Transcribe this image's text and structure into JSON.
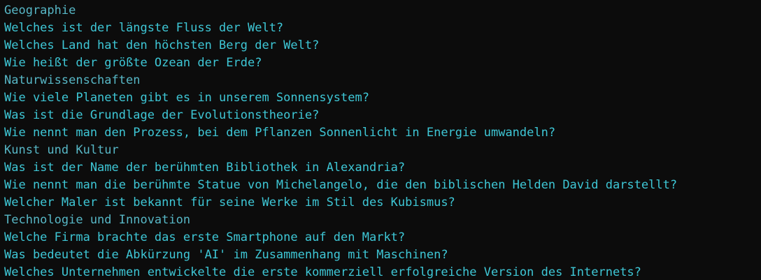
{
  "terminal": {
    "lines": [
      {
        "kind": "category",
        "text": "Geographie"
      },
      {
        "kind": "question",
        "text": "Welches ist der längste Fluss der Welt?"
      },
      {
        "kind": "question",
        "text": "Welches Land hat den höchsten Berg der Welt?"
      },
      {
        "kind": "question",
        "text": "Wie heißt der größte Ozean der Erde?"
      },
      {
        "kind": "category",
        "text": "Naturwissenschaften"
      },
      {
        "kind": "question",
        "text": "Wie viele Planeten gibt es in unserem Sonnensystem?"
      },
      {
        "kind": "question",
        "text": "Was ist die Grundlage der Evolutionstheorie?"
      },
      {
        "kind": "question",
        "text": "Wie nennt man den Prozess, bei dem Pflanzen Sonnenlicht in Energie umwandeln?"
      },
      {
        "kind": "category",
        "text": "Kunst und Kultur"
      },
      {
        "kind": "question",
        "text": "Was ist der Name der berühmten Bibliothek in Alexandria?"
      },
      {
        "kind": "question",
        "text": "Wie nennt man die berühmte Statue von Michelangelo, die den biblischen Helden David darstellt?"
      },
      {
        "kind": "question",
        "text": "Welcher Maler ist bekannt für seine Werke im Stil des Kubismus?"
      },
      {
        "kind": "category",
        "text": "Technologie und Innovation"
      },
      {
        "kind": "question",
        "text": "Welche Firma brachte das erste Smartphone auf den Markt?"
      },
      {
        "kind": "question",
        "text": "Was bedeutet die Abkürzung 'AI' im Zusammenhang mit Maschinen?"
      },
      {
        "kind": "question",
        "text": "Welches Unternehmen entwickelte die erste kommerziell erfolgreiche Version des Internets?"
      }
    ]
  },
  "colors": {
    "background": "#0c0c0c",
    "question_text": "#3ec7d6",
    "category_text": "#57b7c6"
  }
}
